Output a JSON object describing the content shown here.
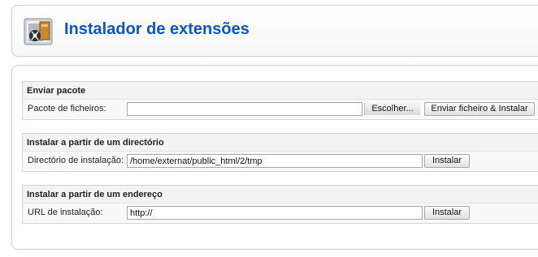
{
  "header": {
    "title": "Instalador de extensões",
    "icon": "package-installer-icon"
  },
  "upload_section": {
    "title": "Enviar pacote",
    "label": "Pacote de ficheiros:",
    "file_value": "",
    "browse_label": "Escolher...",
    "submit_label": "Enviar ficheiro & Instalar"
  },
  "directory_section": {
    "title": "Instalar a partir de um directório",
    "label": "Directório de instalação:",
    "value": "/home/externat/public_html/2/tmp",
    "submit_label": "Instalar"
  },
  "url_section": {
    "title": "Instalar a partir de um endereço",
    "label": "URL de instalação:",
    "value": "http://",
    "submit_label": "Instalar"
  },
  "colors": {
    "title_blue": "#0b55c4",
    "section_header_bg": "#f3f3f3",
    "border": "#d5d5d5"
  }
}
